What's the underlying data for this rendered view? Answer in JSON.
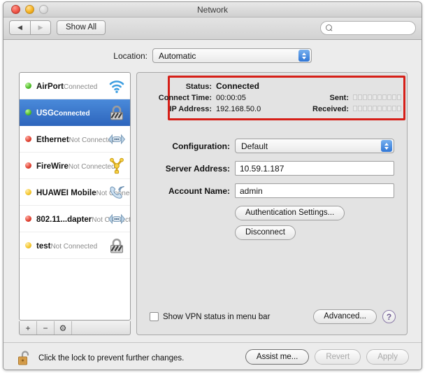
{
  "window": {
    "title": "Network",
    "traffic_lights": [
      "close",
      "minimize",
      "zoom"
    ]
  },
  "toolbar": {
    "back_label": "◀",
    "forward_label": "▶",
    "show_all_label": "Show All",
    "search_value": "",
    "search_placeholder": ""
  },
  "location": {
    "label": "Location:",
    "selected": "Automatic"
  },
  "sidebar": {
    "services": [
      {
        "name": "AirPort",
        "state": "Connected",
        "dot": "green",
        "icon": "wifi-icon",
        "selected": false
      },
      {
        "name": "USG",
        "state": "Connected",
        "dot": "green",
        "icon": "vpn-lock-icon",
        "selected": true
      },
      {
        "name": "Ethernet",
        "state": "Not Connected",
        "dot": "red",
        "icon": "ethernet-icon",
        "selected": false
      },
      {
        "name": "FireWire",
        "state": "Not Connected",
        "dot": "red",
        "icon": "firewire-icon",
        "selected": false
      },
      {
        "name": "HUAWEI Mobile",
        "state": "Not Connected",
        "dot": "yellow",
        "icon": "modem-icon",
        "selected": false
      },
      {
        "name": "802.11...dapter",
        "state": "Not Connected",
        "dot": "red",
        "icon": "ethernet-icon",
        "selected": false
      },
      {
        "name": "test",
        "state": "Not Connected",
        "dot": "yellow",
        "icon": "vpn-lock-icon",
        "selected": false
      }
    ],
    "toolbar": {
      "add_label": "+",
      "remove_label": "−",
      "actions_label": "⚙"
    }
  },
  "status": {
    "highlight_color": "#d61f18",
    "status_label": "Status:",
    "status_value": "Connected",
    "connect_time_label": "Connect Time:",
    "connect_time_value": "00:00:05",
    "ip_address_label": "IP Address:",
    "ip_address_value": "192.168.50.0",
    "sent_label": "Sent:",
    "received_label": "Received:",
    "meter_segments": 10
  },
  "form": {
    "configuration_label": "Configuration:",
    "configuration_value": "Default",
    "server_address_label": "Server Address:",
    "server_address_value": "10.59.1.187",
    "account_name_label": "Account Name:",
    "account_name_value": "admin",
    "auth_settings_label": "Authentication Settings...",
    "disconnect_label": "Disconnect"
  },
  "options": {
    "show_vpn_label": "Show VPN status in menu bar",
    "show_vpn_checked": false,
    "advanced_label": "Advanced...",
    "help_label": "?"
  },
  "footer": {
    "lock_text": "Click the lock to prevent further changes.",
    "assist_label": "Assist me...",
    "revert_label": "Revert",
    "apply_label": "Apply"
  }
}
